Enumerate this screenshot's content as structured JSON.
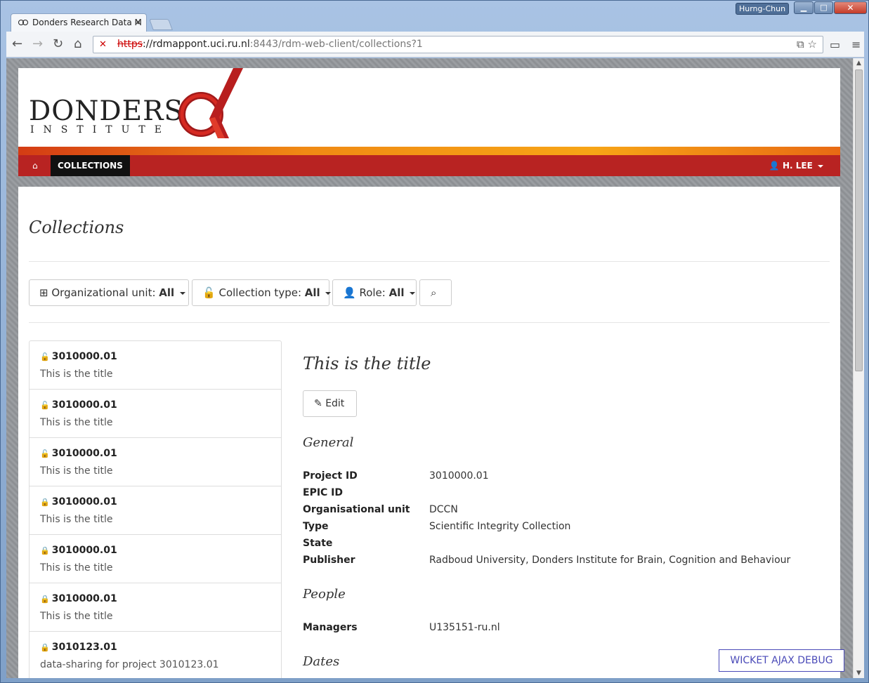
{
  "browser": {
    "tab_title": "Donders Research Data M",
    "url_scheme": "https",
    "url_host": "://rdmappont.uci.ru.nl",
    "url_rest": ":8443/rdm-web-client/collections?1",
    "user_badge": "Hurng-Chun"
  },
  "header": {
    "logo_line1": "DONDERS",
    "logo_line2": "INSTITUTE",
    "nav_collections": "COLLECTIONS",
    "nav_user": "H. LEE",
    "brand_red": "#b82322"
  },
  "page": {
    "title": "Collections"
  },
  "filters": {
    "org_label": "Organizational unit: ",
    "org_value": "All",
    "type_label": "Collection type: ",
    "type_value": "All",
    "role_label": "Role: ",
    "role_value": "All"
  },
  "collections": [
    {
      "id": "3010000.01",
      "title": "This is the title"
    },
    {
      "id": "3010000.01",
      "title": "This is the title"
    },
    {
      "id": "3010000.01",
      "title": "This is the title"
    },
    {
      "id": "3010000.01",
      "title": "This is the title"
    },
    {
      "id": "3010000.01",
      "title": "This is the title"
    },
    {
      "id": "3010000.01",
      "title": "This is the title"
    },
    {
      "id": "3010123.01",
      "title": "data-sharing for project 3010123.01"
    }
  ],
  "detail": {
    "title": "This is the title",
    "edit_label": "Edit",
    "section_general": "General",
    "section_people": "People",
    "section_dates": "Dates",
    "fields": {
      "project_id_k": "Project ID",
      "project_id_v": "3010000.01",
      "epic_id_k": "EPIC ID",
      "epic_id_v": "",
      "org_unit_k": "Organisational unit",
      "org_unit_v": "DCCN",
      "type_k": "Type",
      "type_v": "Scientific Integrity Collection",
      "state_k": "State",
      "state_v": "",
      "publisher_k": "Publisher",
      "publisher_v": "Radboud University, Donders Institute for Brain, Cognition and Behaviour",
      "managers_k": "Managers",
      "managers_v": "U135151-ru.nl"
    }
  },
  "debug": {
    "wicket_label": "WICKET AJAX DEBUG"
  }
}
